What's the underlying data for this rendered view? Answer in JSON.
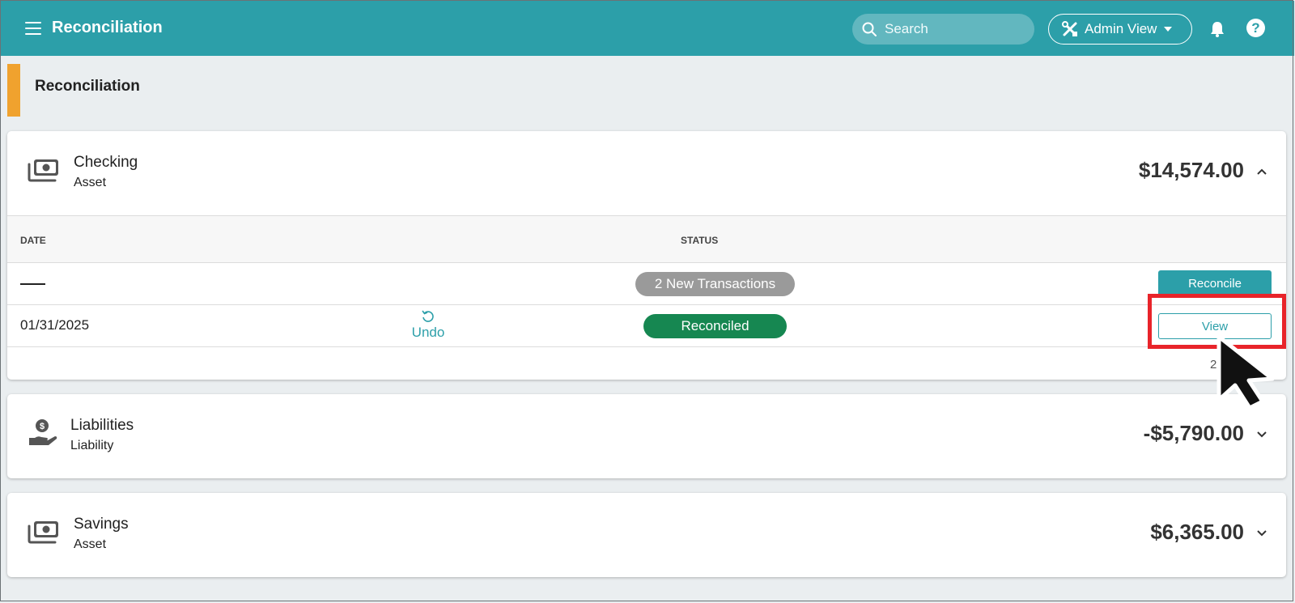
{
  "app": {
    "title": "Reconciliation"
  },
  "search": {
    "placeholder": "Search"
  },
  "admin_view": {
    "label": "Admin View"
  },
  "page": {
    "title": "Reconciliation"
  },
  "accounts": [
    {
      "name": "Checking",
      "type": "Asset",
      "amount": "$14,574.00",
      "expanded": true,
      "icon": "money-icon",
      "table": {
        "headers": {
          "date": "DATE",
          "status": "STATUS"
        },
        "rows": [
          {
            "date": "—",
            "status": "2 New Transactions",
            "action": "Reconcile"
          },
          {
            "date": "01/31/2025",
            "undo": "Undo",
            "status": "Reconciled",
            "action": "View"
          }
        ],
        "footer": "2"
      }
    },
    {
      "name": "Liabilities",
      "type": "Liability",
      "amount": "-$5,790.00",
      "expanded": false,
      "icon": "hand-dollar-icon"
    },
    {
      "name": "Savings",
      "type": "Asset",
      "amount": "$6,365.00",
      "expanded": false,
      "icon": "money-icon"
    }
  ],
  "colors": {
    "topbar": "#2c9fa9",
    "accent": "#f0a22e",
    "reconciled": "#168751",
    "pending": "#9a9a9a",
    "highlight": "#e8242a"
  }
}
